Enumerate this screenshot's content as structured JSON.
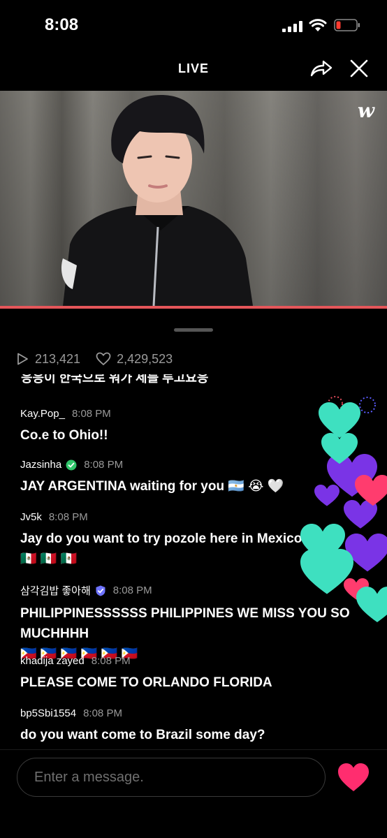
{
  "status_bar": {
    "time": "8:08",
    "battery_color": "#ff3b30"
  },
  "header": {
    "title": "LIVE",
    "share_icon": "share-arrow-icon",
    "close_icon": "close-icon"
  },
  "video": {
    "watermark": "w",
    "progress_percent": 100,
    "progress_color": "#e5565a"
  },
  "stats": {
    "views": "213,421",
    "likes": "2,429,523",
    "views_icon": "play-icon",
    "likes_icon": "heart-outline-icon"
  },
  "chat": {
    "cut_off_text": "응응이 한국으로 워가 세를 루고요응",
    "messages": [
      {
        "name": "Kay.Pop_",
        "time": "8:08 PM",
        "text": "Co.e to Ohio!!"
      },
      {
        "name": "Jazsinha",
        "time": "8:08 PM",
        "text": "JAY ARGENTINA waiting for you",
        "badge": "verified-green-icon",
        "emoji": "🇦🇷 😭 🤍"
      },
      {
        "name": "Jv5k",
        "time": "8:08 PM",
        "text": "Jay do you want to try pozole here in Mexico",
        "flags": "🇲🇽 🇲🇽 🇲🇽"
      },
      {
        "name": "삼각김밥 좋아해",
        "time": "8:08 PM",
        "text": "PHILIPPINESSSSSS PHILIPPINES WE MISS YOU SO MUCHHHH",
        "badge": "verified-blue-icon",
        "flags": "🇵🇭 🇵🇭 🇵🇭 🇵🇭 🇵🇭 🇵🇭"
      },
      {
        "name": "khadija zayed",
        "time": "8:08 PM",
        "text": "PLEASE COME TO ORLANDO FLORIDA"
      },
      {
        "name": "bp5Sbi1554",
        "time": "8:08 PM",
        "text": "do you want come to Brazil some day?"
      }
    ]
  },
  "input": {
    "placeholder": "Enter a message.",
    "like_icon": "heart-filled-icon",
    "like_color": "#ff2d6f"
  }
}
